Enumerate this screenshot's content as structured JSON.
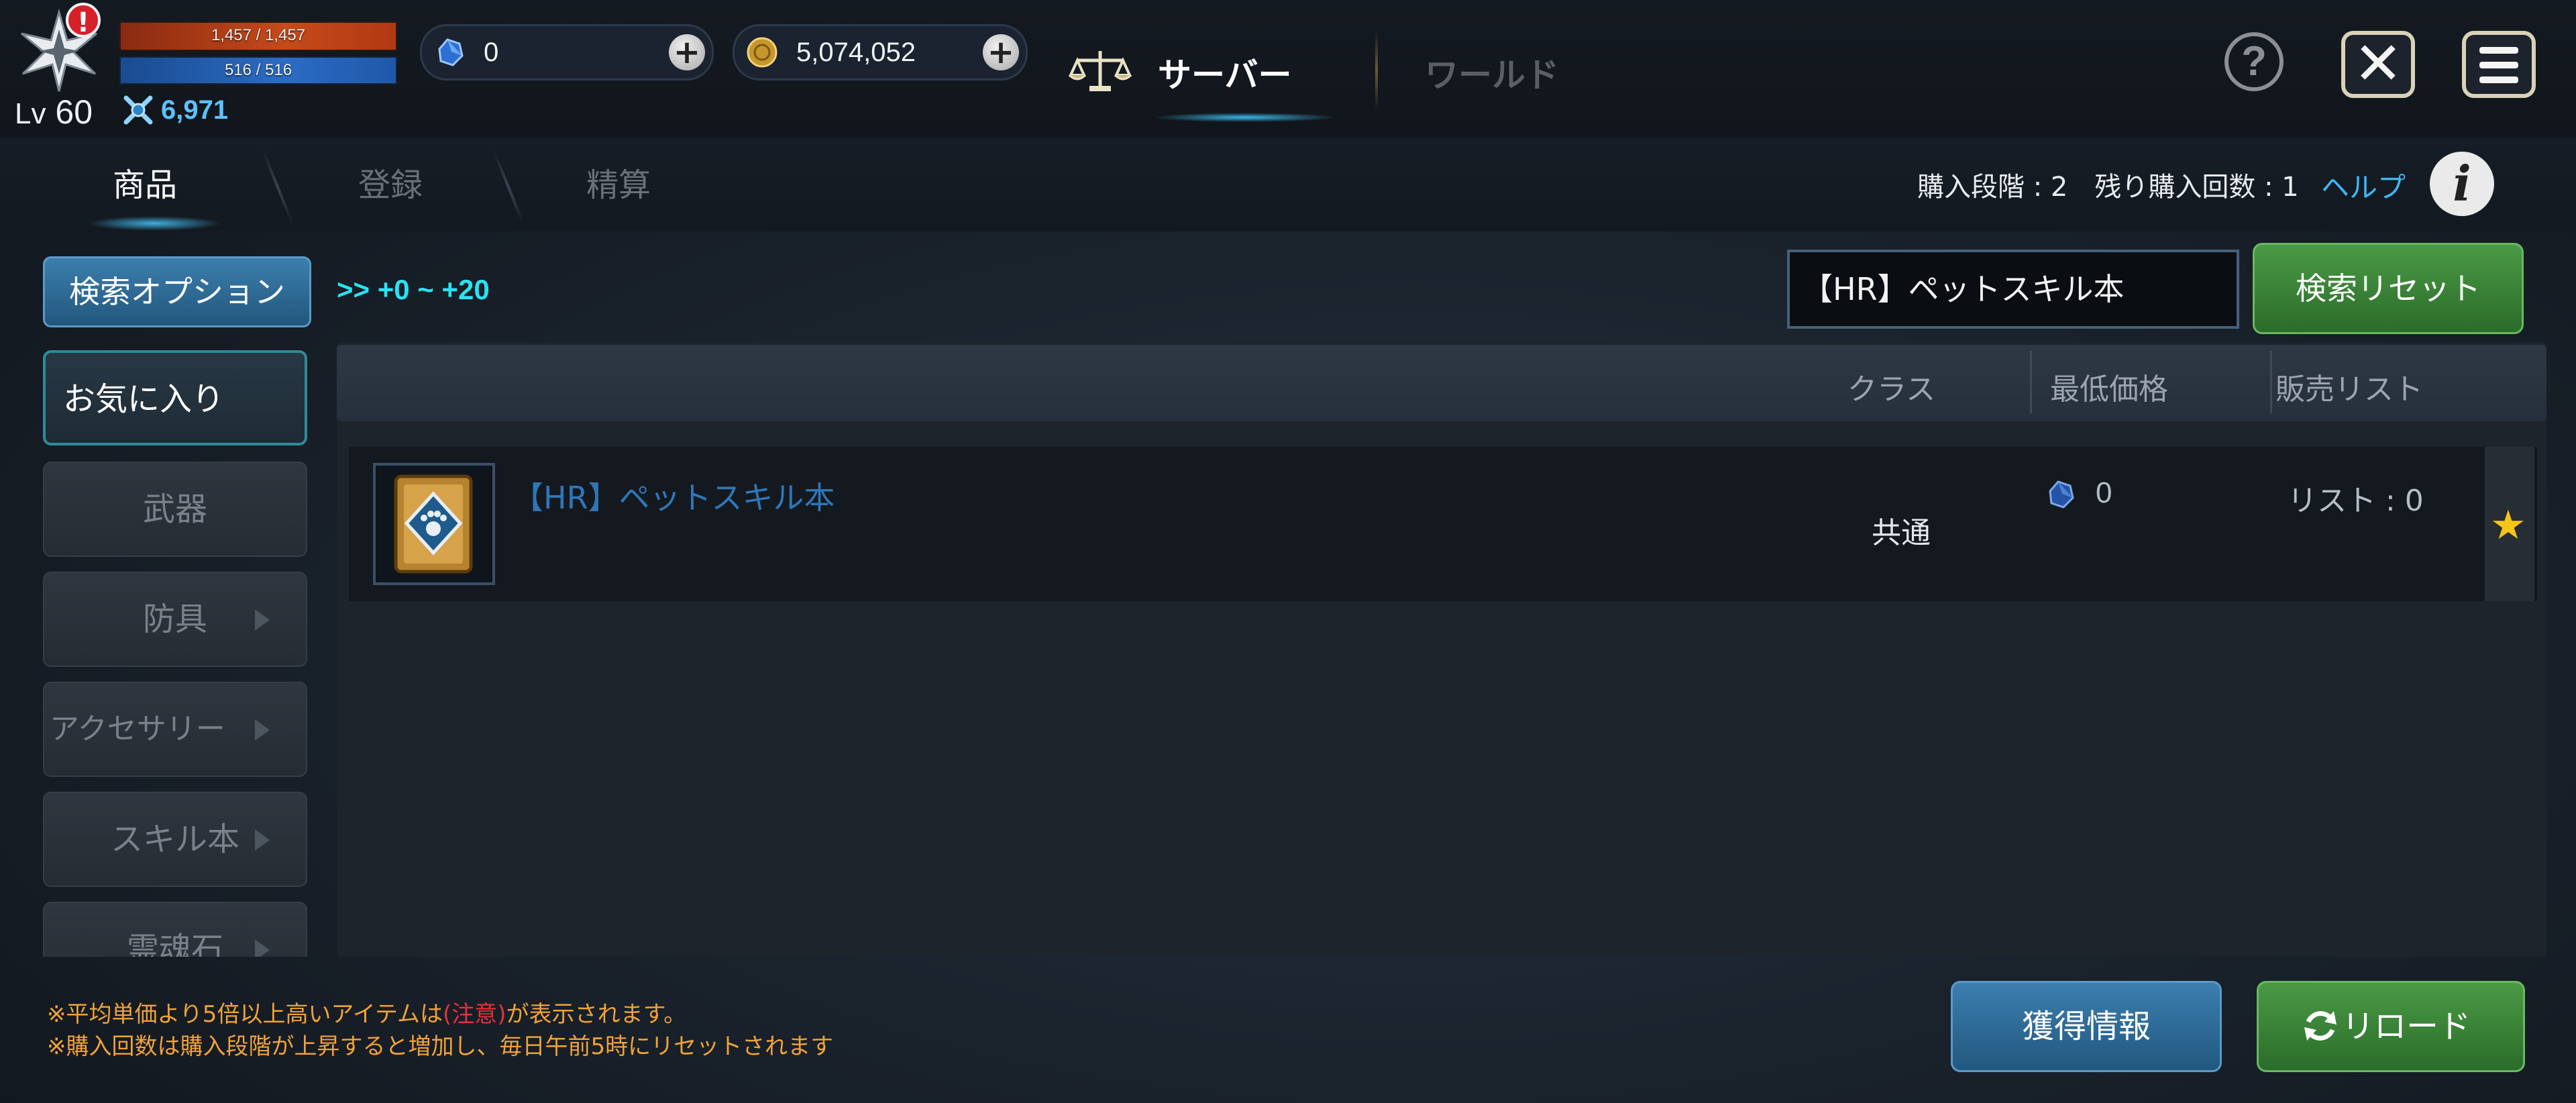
{
  "hud": {
    "hp_text": "1,457 / 1,457",
    "mp_text": "516 / 516",
    "hp_fraction": 1.0,
    "mp_fraction": 1.0,
    "level_prefix": "Lv",
    "level_value": "60",
    "combat_power": "6,971",
    "alert_mark": "!"
  },
  "currencies": {
    "gem": "0",
    "gold": "5,074,052"
  },
  "top_tabs": {
    "server": "サーバー",
    "world": "ワールド"
  },
  "window_buttons": {
    "help": "?",
    "close": "✕"
  },
  "sub_tabs": [
    "商品",
    "登録",
    "精算"
  ],
  "purchase_info": "購入段階 : 2　残り購入回数 : 1",
  "help_link": "ヘルプ",
  "info_icon": "i",
  "search": {
    "options_button": "検索オプション",
    "range_label": ">> +0 ~ +20",
    "query": "【HR】ペットスキル本",
    "reset_button": "検索リセット"
  },
  "categories": [
    {
      "label": "お気に入り",
      "active": true
    },
    {
      "label": "武器",
      "active": false
    },
    {
      "label": "防具",
      "active": false
    },
    {
      "label": "アクセサリー",
      "active": false
    },
    {
      "label": "スキル本",
      "active": false
    },
    {
      "label": "霊魂石",
      "active": false
    }
  ],
  "table": {
    "headers": {
      "class": "クラス",
      "min_price": "最低価格",
      "sale_list": "販売リスト"
    },
    "rows": [
      {
        "name": "【HR】ペットスキル本",
        "class": "共通",
        "min_price": "0",
        "sale_list": "リスト : 0",
        "favorite": "★",
        "icon": "paw-book-icon"
      }
    ]
  },
  "footer": {
    "note1_prefix": "※平均単価より5倍以上高いアイテムは",
    "note1_warn": "(注意)",
    "note1_suffix": "が表示されます。",
    "note2": "※購入回数は購入段階が上昇すると増加し、毎日午前5時にリセットされます",
    "acquire_button": "獲得情報",
    "reload_button": "リロード"
  },
  "colors": {
    "accent_cyan": "#28e3f2",
    "link_blue": "#3fb7f4",
    "note_orange": "#f0a23a",
    "warn_red": "#e5313a",
    "green_button": "#3f8a3b",
    "blue_button": "#2d6a96",
    "favorite_star": "#f5c518"
  }
}
